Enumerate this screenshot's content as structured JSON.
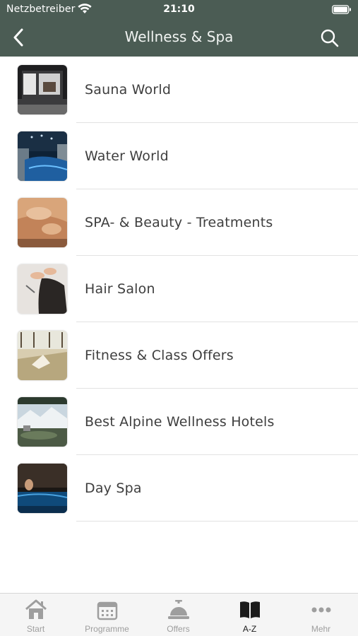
{
  "status_bar": {
    "carrier": "Netzbetreiber",
    "time": "21:10"
  },
  "header": {
    "title": "Wellness & Spa",
    "background_color": "#4b5c54"
  },
  "list": {
    "items": [
      {
        "label": "Sauna World",
        "thumbnail": "sauna-thumbnail"
      },
      {
        "label": "Water World",
        "thumbnail": "pool-thumbnail"
      },
      {
        "label": "SPA- & Beauty - Treatments",
        "thumbnail": "massage-thumbnail"
      },
      {
        "label": "Hair Salon",
        "thumbnail": "hair-salon-thumbnail"
      },
      {
        "label": "Fitness & Class Offers",
        "thumbnail": "yoga-thumbnail"
      },
      {
        "label": "Best Alpine Wellness Hotels",
        "thumbnail": "alpine-hotel-thumbnail"
      },
      {
        "label": "Day Spa",
        "thumbnail": "day-spa-thumbnail"
      }
    ]
  },
  "tab_bar": {
    "active_color": "#1c1c1c",
    "inactive_color": "#9e9e9e",
    "tabs": [
      {
        "label": "Start",
        "icon": "house-icon",
        "active": false
      },
      {
        "label": "Programme",
        "icon": "calendar-icon",
        "active": false
      },
      {
        "label": "Offers",
        "icon": "service-bell-icon",
        "active": false
      },
      {
        "label": "A-Z",
        "icon": "open-book-icon",
        "active": true
      },
      {
        "label": "Mehr",
        "icon": "more-dots-icon",
        "active": false
      }
    ]
  }
}
